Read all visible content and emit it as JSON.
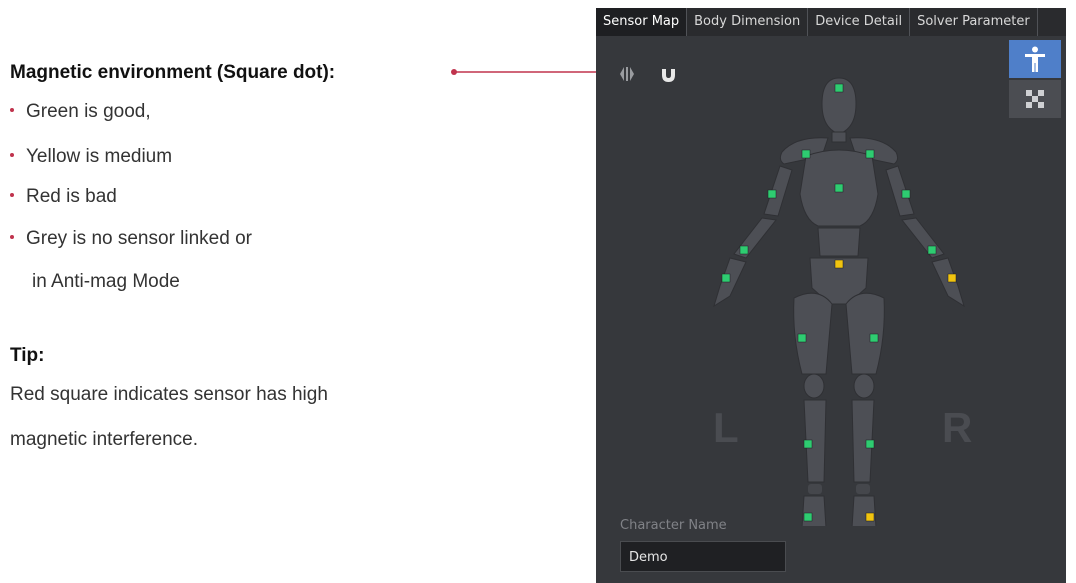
{
  "annotation": {
    "title": "Magnetic environment (Square dot):",
    "items": [
      "Green is good,",
      "Yellow is medium",
      "Red is bad",
      "Grey is no sensor linked or"
    ],
    "item_continuation": "in Anti-mag Mode",
    "tip_title": "Tip:",
    "tip_lines": [
      "Red square indicates sensor has high",
      "magnetic interference."
    ]
  },
  "tabs": [
    "Sensor Map",
    "Body Dimension",
    "Device Detail",
    "Solver Parameter"
  ],
  "active_tab": "Sensor Map",
  "sidebar": {
    "buttons": [
      "human-figure-icon",
      "grid-view-icon"
    ]
  },
  "toolbar": {
    "icons": [
      "swap-icon",
      "magnet-icon"
    ]
  },
  "body_labels": {
    "left": "L",
    "right": "R"
  },
  "character": {
    "label": "Character Name",
    "value": "Demo"
  },
  "status_colors": {
    "good": "#2ecc71",
    "medium": "#f1c40f",
    "bad": "#e23b3b",
    "none": "#8a8a8a"
  },
  "sensors": [
    {
      "name": "head",
      "status": "good"
    },
    {
      "name": "left-shoulder",
      "status": "good"
    },
    {
      "name": "right-shoulder",
      "status": "good"
    },
    {
      "name": "chest",
      "status": "good"
    },
    {
      "name": "left-upper-arm",
      "status": "good"
    },
    {
      "name": "right-upper-arm",
      "status": "good"
    },
    {
      "name": "left-forearm",
      "status": "good"
    },
    {
      "name": "right-forearm",
      "status": "good"
    },
    {
      "name": "hips",
      "status": "medium"
    },
    {
      "name": "left-hand",
      "status": "good"
    },
    {
      "name": "right-hand",
      "status": "medium"
    },
    {
      "name": "left-thigh",
      "status": "good"
    },
    {
      "name": "right-thigh",
      "status": "good"
    },
    {
      "name": "left-shin",
      "status": "good"
    },
    {
      "name": "right-shin",
      "status": "good"
    },
    {
      "name": "left-foot",
      "status": "good"
    },
    {
      "name": "right-foot",
      "status": "medium"
    }
  ]
}
